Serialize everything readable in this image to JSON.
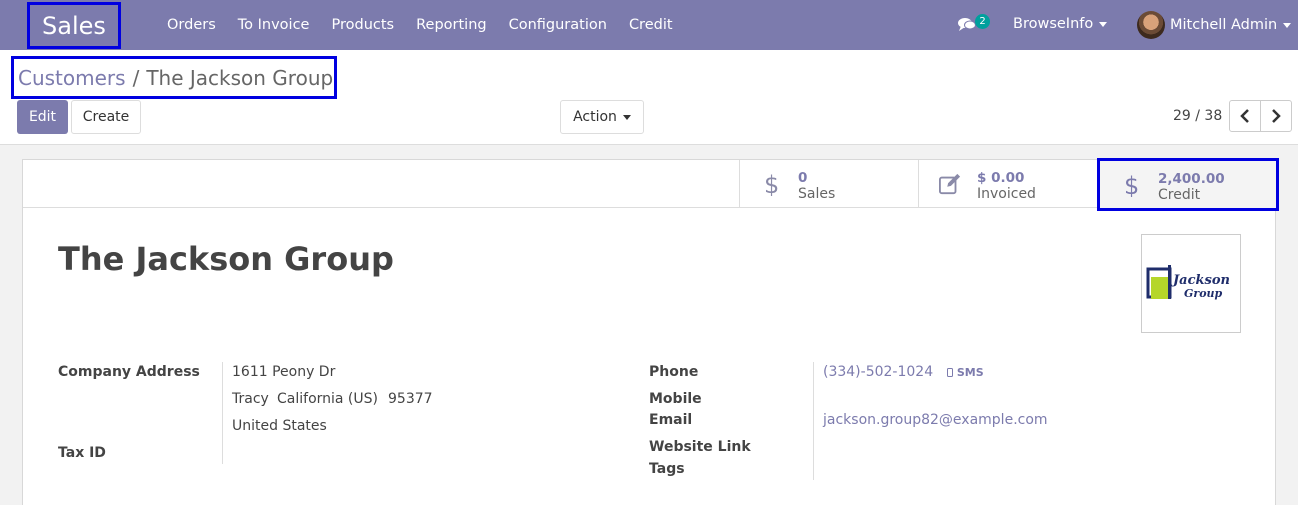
{
  "navbar": {
    "app_name": "Sales",
    "menu": [
      "Orders",
      "To Invoice",
      "Products",
      "Reporting",
      "Configuration",
      "Credit"
    ],
    "messages_count": "2",
    "company": "BrowseInfo",
    "user": "Mitchell Admin",
    "bg_color": "#7c7bad"
  },
  "breadcrumb": {
    "parent": "Customers",
    "separator": "/",
    "current": "The Jackson Group"
  },
  "buttons": {
    "edit": "Edit",
    "create": "Create",
    "action": "Action"
  },
  "pager": {
    "value": "29 / 38"
  },
  "stats": {
    "sales": {
      "value": "0",
      "label": "Sales",
      "icon": "dollar-icon"
    },
    "invoiced": {
      "value": "$ 0.00",
      "label": "Invoiced",
      "icon": "pencil-square-icon"
    },
    "credit": {
      "value": "2,400.00",
      "label": "Credit",
      "icon": "dollar-icon"
    }
  },
  "partner": {
    "name": "The Jackson Group",
    "logo_text_line1": "Jackson",
    "logo_text_line2": "Group"
  },
  "fields": {
    "company_address_label": "Company Address",
    "street": "1611 Peony Dr",
    "city": "Tracy",
    "state": "California (US)",
    "zip": "95377",
    "country": "United States",
    "tax_id_label": "Tax ID",
    "phone_label": "Phone",
    "phone": "(334)-502-1024",
    "sms": "SMS",
    "mobile_label": "Mobile",
    "email_label": "Email",
    "email": "jackson.group82@example.com",
    "website_label": "Website Link",
    "tags_label": "Tags"
  }
}
